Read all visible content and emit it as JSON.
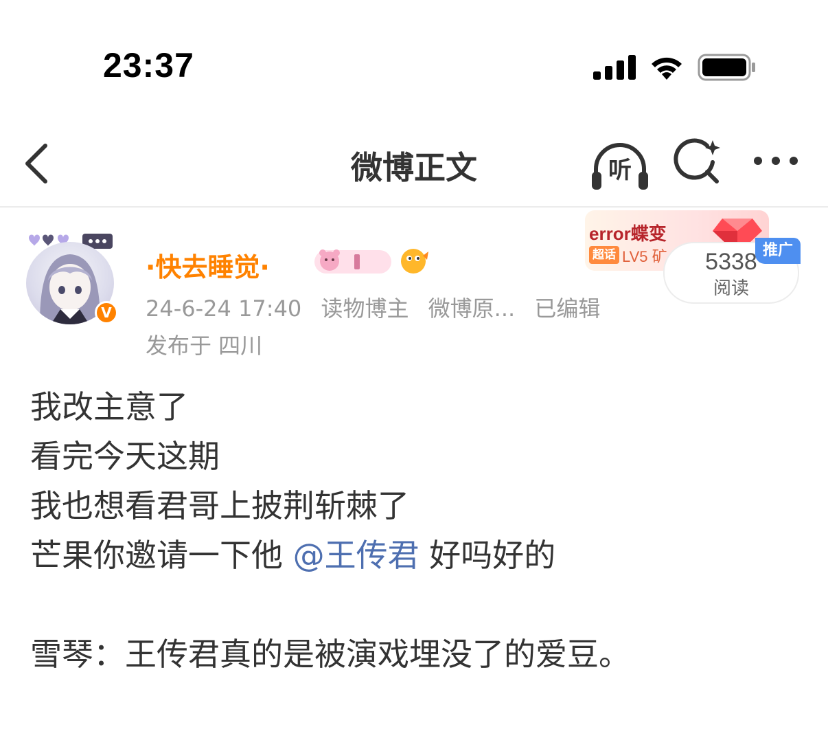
{
  "status_bar": {
    "time": "23:37",
    "icons": [
      "signal-bars-icon",
      "wifi-icon",
      "battery-icon"
    ]
  },
  "nav": {
    "title": "微博正文",
    "listen_label": "听",
    "icons": [
      "chevron-left-icon",
      "headphones-icon",
      "search-sparkle-icon",
      "more-icon"
    ]
  },
  "post": {
    "author": "·快去睡觉·",
    "verified_mark": "V",
    "meta": {
      "datetime": "24-6-24 17:40",
      "role": "读物博主",
      "source": "微博原...",
      "edited": "已编辑"
    },
    "location": "发布于 四川",
    "read_count": "5338",
    "read_label": "阅读",
    "body": {
      "line1": "我改主意了",
      "line2": "看完今天这期",
      "line3": "我也想看君哥上披荆斩棘了",
      "line4_prefix": "芒果你邀请一下他 ",
      "mention": "@王传君",
      "line4_suffix": " 好吗好的",
      "line5": "雪琴：王传君真的是被演戏埋没了的爱豆。"
    }
  },
  "promo": {
    "title": "error蝶变",
    "tag": "超话",
    "level": "LV5 矿",
    "ad_label": "推广"
  },
  "colors": {
    "accent_orange": "#ff8200",
    "mention_blue": "#4e6fb0",
    "ad_blue": "#4e8ff0",
    "meta_gray": "#999999"
  }
}
